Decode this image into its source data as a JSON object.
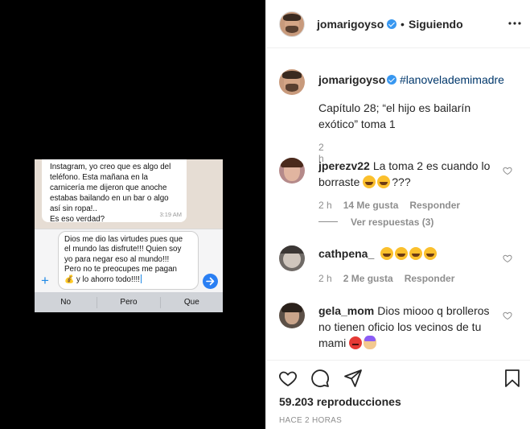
{
  "media": {
    "chat_bubble": {
      "text": "Instagram, yo creo que es algo del\nteléfono. Esta mañana en la\ncarnicería me dijeron que anoche\nestabas bailando en un bar o algo\nasí sin ropa!..\nEs eso verdad?",
      "time": "3:19 AM"
    },
    "compose_text": "Dios me dio las virtudes pues que\nel mundo las disfrute!!! Quien soy\nyo para negar eso al mundo!!!\nPero no te preocupes me pagan\n💰 y lo ahorro todo!!!!",
    "suggestions": [
      "No",
      "Pero",
      "Que"
    ]
  },
  "header": {
    "username": "jomarigoyso",
    "separator": "•",
    "follow_label": "Siguiendo",
    "more_icon": "more-horizontal-icon"
  },
  "caption": {
    "username": "jomarigoyso",
    "hashtag": "#lanovelademimadre",
    "text": "Capítulo 28; “el hijo es bailarín exótico” toma 1",
    "time": "2 h"
  },
  "comments": [
    {
      "username": "jperezv22",
      "text": "La toma 2 es cuando lo borraste",
      "suffix": "???",
      "time": "2 h",
      "likes": "14 Me gusta",
      "reply": "Responder",
      "view_replies": "Ver respuestas (3)"
    },
    {
      "username": "cathpena_",
      "text": "",
      "time": "2 h",
      "likes": "2 Me gusta",
      "reply": "Responder"
    },
    {
      "username": "gela_mom",
      "text": "Dios miooo q brolleros no tienen oficio los vecinos de tu mami"
    }
  ],
  "footer": {
    "views": "59.203 reproducciones",
    "ago": "HACE 2 HORAS"
  },
  "colors": {
    "link": "#00376b",
    "verified": "#3897f0",
    "muted": "#8e8e8e",
    "text": "#262626"
  }
}
